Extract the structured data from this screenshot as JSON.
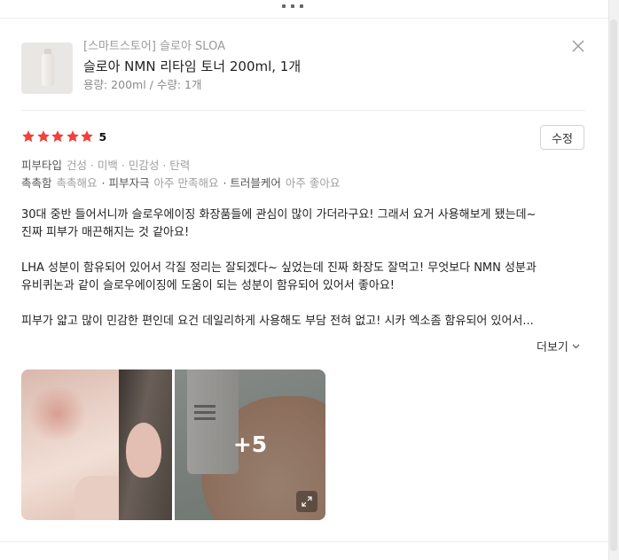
{
  "product": {
    "store": "[스마트스토어] 슬로아 SLOA",
    "name": "슬로아 NMN 리타임 토너 200ml, 1개",
    "option": "용량: 200ml / 수량: 1개"
  },
  "review": {
    "rating": 5,
    "score_label": "5",
    "edit_label": "수정",
    "attributes": [
      {
        "items": [
          {
            "key": "피부타입",
            "value": "건성 · 미백 · 민감성 · 탄력"
          }
        ]
      },
      {
        "items": [
          {
            "key": "촉촉함",
            "value": "촉촉해요"
          },
          {
            "key": "· 피부자극",
            "value": "아주 만족해요"
          },
          {
            "key": "· 트러블케어",
            "value": "아주 좋아요"
          }
        ]
      }
    ],
    "paragraphs": [
      [
        "30대 중반 들어서니까 슬로우에이징 화장품들에 관심이 많이 가더라구요! 그래서 요거 사용해보게 됐는데~",
        "진짜 피부가 매끈해지는 것 같아요!"
      ],
      [
        "LHA 성분이 함유되어 있어서 각질 정리는 잘되겠다~ 싶었는데 진짜 화장도 잘먹고! 무엇보다 NMN 성분과",
        "유비퀴논과 같이 슬로우에이징에 도움이 되는 성분이 함유되어 있어서 좋아요!"
      ],
      [
        "피부가 얇고 많이 민감한 편인데 요건 데일리하게 사용해도 부담 전혀 없고! 시카 엑소좀 함유되어 있어서..."
      ]
    ],
    "more_label": "더보기",
    "photos": {
      "extra_count_label": "+5"
    }
  },
  "icons": {
    "close": "close-icon",
    "star": "star-icon",
    "chevron": "chevron-down-icon",
    "expand": "expand-icon"
  },
  "colors": {
    "star": "#f0413a",
    "muted": "#9a9a9a"
  }
}
